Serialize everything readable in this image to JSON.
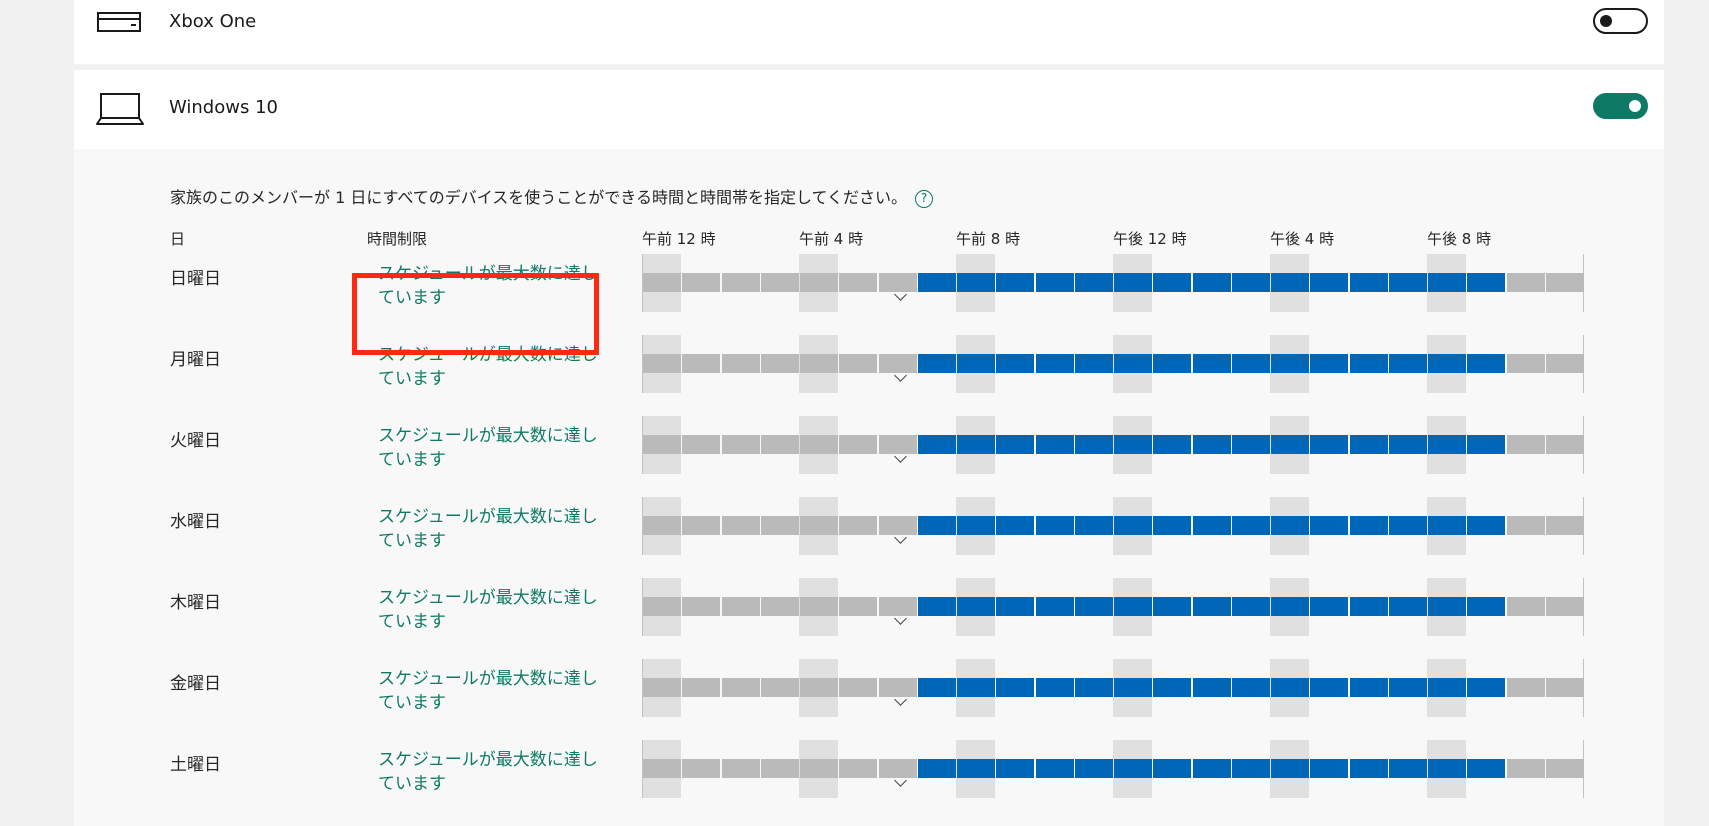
{
  "devices": {
    "xbox": {
      "name": "Xbox One",
      "icon": "console-icon",
      "enabled": false
    },
    "windows": {
      "name": "Windows 10",
      "icon": "laptop-icon",
      "enabled": true
    }
  },
  "schedule": {
    "instruction": "家族のこのメンバーが 1 日にすべてのデバイスを使うことができる時間と時間帯を指定してください。",
    "help_glyph": "?",
    "columns": {
      "day": "日",
      "limit": "時間制限"
    },
    "hour_labels": [
      "午前 12 時",
      "午前 4 時",
      "午前 8 時",
      "午後 12 時",
      "午後 4 時",
      "午後 8 時"
    ],
    "days": [
      {
        "label": "日曜日",
        "limit": "スケジュールが最大数に達しています",
        "allowed_from_slot": 7,
        "allowed_to_slot": 22,
        "total_slots": 24
      },
      {
        "label": "月曜日",
        "limit": "スケジュールが最大数に達しています",
        "allowed_from_slot": 7,
        "allowed_to_slot": 22,
        "total_slots": 24
      },
      {
        "label": "火曜日",
        "limit": "スケジュールが最大数に達しています",
        "allowed_from_slot": 7,
        "allowed_to_slot": 22,
        "total_slots": 24
      },
      {
        "label": "水曜日",
        "limit": "スケジュールが最大数に達しています",
        "allowed_from_slot": 7,
        "allowed_to_slot": 22,
        "total_slots": 24
      },
      {
        "label": "木曜日",
        "limit": "スケジュールが最大数に達しています",
        "allowed_from_slot": 7,
        "allowed_to_slot": 22,
        "total_slots": 24
      },
      {
        "label": "金曜日",
        "limit": "スケジュールが最大数に達しています",
        "allowed_from_slot": 7,
        "allowed_to_slot": 22,
        "total_slots": 24
      },
      {
        "label": "土曜日",
        "limit": "スケジュールが最大数に達しています",
        "allowed_from_slot": 7,
        "allowed_to_slot": 22,
        "total_slots": 24
      }
    ]
  },
  "colors": {
    "accent": "#0e7a65",
    "allowed": "#0067b8",
    "blocked": "#bababa",
    "highlight": "#ff2a0e"
  }
}
